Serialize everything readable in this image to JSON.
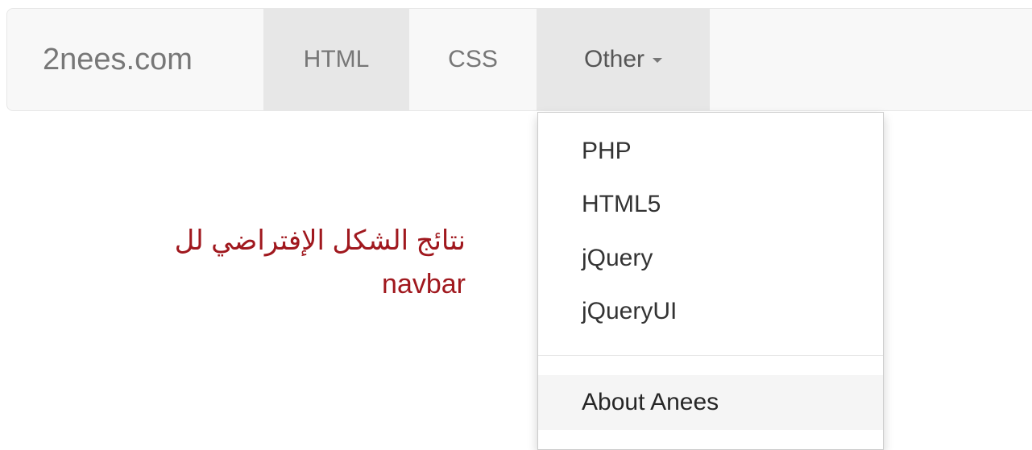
{
  "navbar": {
    "brand": "2nees.com",
    "items": [
      {
        "label": "HTML"
      },
      {
        "label": "CSS"
      },
      {
        "label": "Other",
        "icon": "caret-down-icon"
      }
    ]
  },
  "dropdown": {
    "items": [
      {
        "label": "PHP"
      },
      {
        "label": "HTML5"
      },
      {
        "label": "jQuery"
      },
      {
        "label": "jQueryUI"
      }
    ],
    "footer_item": {
      "label": "About Anees"
    }
  },
  "caption": {
    "line1": "نتائج الشكل الإفتراضي لل",
    "line2": "navbar"
  },
  "colors": {
    "navbar_bg": "#f8f8f8",
    "active_bg": "#e7e7e7",
    "caption_text": "#a0181e"
  }
}
